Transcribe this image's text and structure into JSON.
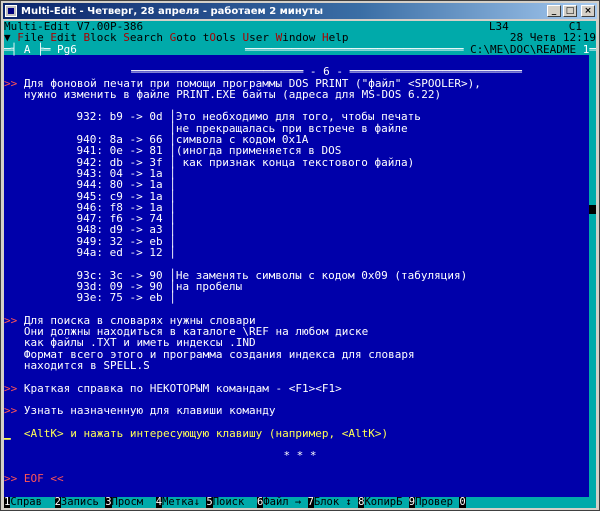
{
  "window": {
    "title": "Multi-Edit - Четверг, 28 апреля - работаем 2 минуты",
    "btn_min": "_",
    "btn_max": "□",
    "btn_close": "×"
  },
  "status": {
    "app_version": "Multi-Edit V7.00P-386",
    "line": "L34",
    "col": "C1",
    "date_time": "28 Четв 12:19"
  },
  "menu": [
    {
      "hot": "F",
      "rest": "ile"
    },
    {
      "hot": "E",
      "rest": "dit"
    },
    {
      "hot": "B",
      "rest": "lock"
    },
    {
      "hot": "S",
      "rest": "earch"
    },
    {
      "hot": "G",
      "rest": "oto"
    },
    {
      "pre": "t",
      "hot": "O",
      "rest": "ols"
    },
    {
      "hot": "U",
      "rest": "ser"
    },
    {
      "hot": "W",
      "rest": "indow"
    },
    {
      "hot": "H",
      "rest": "elp"
    }
  ],
  "menu_arrow": "▼",
  "frame": {
    "left": "═╡ A ╞═ Pg6",
    "file": " C:\\ME\\DOC\\README ",
    "num": "1"
  },
  "doc": {
    "page_header": "- 6 -",
    "p1_l1": "Для фоновой печати при помощи программы DOS PRINT (\"файл\" <SPOOLER>),",
    "p1_l2": "нужно изменить в файле PRINT.EXE байты (адреса для MS-DOS 6.22)",
    "bytes_a": [
      {
        "addr": "932: b9 -> 0d",
        "note": "Это необходимо для того, чтобы печать"
      },
      {
        "addr": "",
        "note": "не прекращалась при встрече в файле"
      },
      {
        "addr": "940: 8a -> 66",
        "note": "символа с кодом 0x1A"
      },
      {
        "addr": "941: 0e -> 81",
        "note": "(иногда применяется в DOS"
      },
      {
        "addr": "942: db -> 3f",
        "note": " как признак конца текстового файла)"
      },
      {
        "addr": "943: 04 -> 1a",
        "note": ""
      },
      {
        "addr": "944: 80 -> 1a",
        "note": ""
      },
      {
        "addr": "945: c9 -> 1a",
        "note": ""
      },
      {
        "addr": "946: f8 -> 1a",
        "note": ""
      },
      {
        "addr": "947: f6 -> 74",
        "note": ""
      },
      {
        "addr": "948: d9 -> a3",
        "note": ""
      },
      {
        "addr": "949: 32 -> eb",
        "note": ""
      },
      {
        "addr": "94a: ed -> 12",
        "note": ""
      }
    ],
    "bytes_b": [
      {
        "addr": "93c: 3c -> 90",
        "note": "Не заменять символы с кодом 0x09 (табуляция)"
      },
      {
        "addr": "93d: 09 -> 90",
        "note": "на пробелы"
      },
      {
        "addr": "93e: 75 -> eb",
        "note": ""
      }
    ],
    "p2_l1": "Для поиска в словарях нужны словари",
    "p2_l2": "Они должны находиться в каталоге \\REF на любом диске",
    "p2_l3": "как файлы .TXT и иметь индексы .IND",
    "p2_l4": "Формат всего этого и программа создания индекса для словаря",
    "p2_l5": "находится в SPELL.S",
    "p3": "Краткая справка по НЕКОТОРЫМ командам - <F1><F1>",
    "p4": "Узнать назначенную для клавиши команду",
    "p5": "<AltK> и нажать интересующую клавишу (например, <AltK>)",
    "stars": "* * *",
    "eof": "EOF",
    "bullet": ">>",
    "eof_tail": "<<"
  },
  "fkeys": [
    {
      "num": "1",
      "label": "Справ  "
    },
    {
      "num": "2",
      "label": "Запись "
    },
    {
      "num": "3",
      "label": "Просм  "
    },
    {
      "num": "4",
      "label": "Метка↓ "
    },
    {
      "num": "5",
      "label": "Поиск  "
    },
    {
      "num": "6",
      "label": "Файл → "
    },
    {
      "num": "7",
      "label": "Блок ↕ "
    },
    {
      "num": "8",
      "label": "КопирБ "
    },
    {
      "num": "9",
      "label": "Провер "
    },
    {
      "num": "0",
      "label": ""
    }
  ]
}
